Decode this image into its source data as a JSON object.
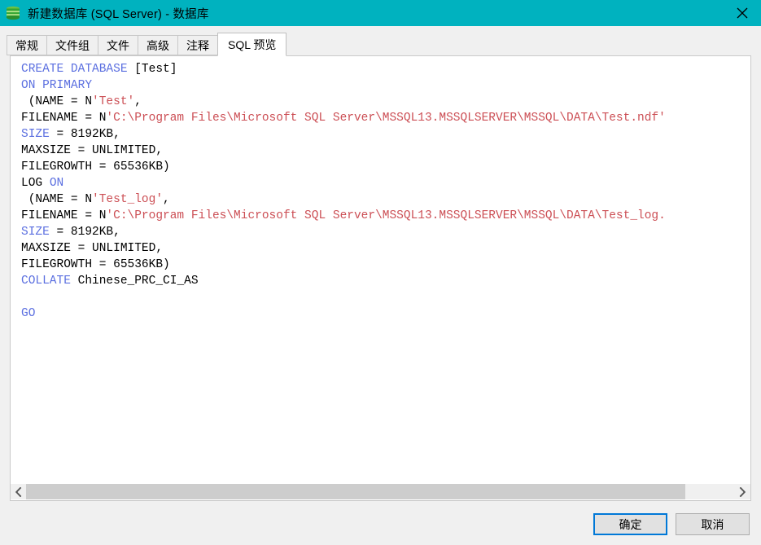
{
  "window": {
    "title": "新建数据库 (SQL Server) - 数据库",
    "icon": "database-icon",
    "close_label": "✕",
    "titlebar_color": "#00b2bf"
  },
  "tabs": [
    {
      "label": "常规",
      "active": false
    },
    {
      "label": "文件组",
      "active": false
    },
    {
      "label": "文件",
      "active": false
    },
    {
      "label": "高级",
      "active": false
    },
    {
      "label": "注释",
      "active": false
    },
    {
      "label": "SQL 预览",
      "active": true
    }
  ],
  "sql_preview": {
    "lines": [
      [
        {
          "t": "CREATE DATABASE ",
          "c": "kw"
        },
        {
          "t": "[Test]",
          "c": ""
        }
      ],
      [
        {
          "t": "ON PRIMARY",
          "c": "kw"
        }
      ],
      [
        {
          "t": " (NAME = N",
          "c": ""
        },
        {
          "t": "'Test'",
          "c": "str"
        },
        {
          "t": ",",
          "c": ""
        }
      ],
      [
        {
          "t": "FILENAME = N",
          "c": ""
        },
        {
          "t": "'C:\\Program Files\\Microsoft SQL Server\\MSSQL13.MSSQLSERVER\\MSSQL\\DATA\\Test.ndf'",
          "c": "str"
        }
      ],
      [
        {
          "t": "SIZE",
          "c": "kw"
        },
        {
          "t": " = 8192KB,",
          "c": ""
        }
      ],
      [
        {
          "t": "MAXSIZE = UNLIMITED,",
          "c": ""
        }
      ],
      [
        {
          "t": "FILEGROWTH = 65536KB)",
          "c": ""
        }
      ],
      [
        {
          "t": "LOG ",
          "c": ""
        },
        {
          "t": "ON",
          "c": "kw"
        }
      ],
      [
        {
          "t": " (NAME = N",
          "c": ""
        },
        {
          "t": "'Test_log'",
          "c": "str"
        },
        {
          "t": ",",
          "c": ""
        }
      ],
      [
        {
          "t": "FILENAME = N",
          "c": ""
        },
        {
          "t": "'C:\\Program Files\\Microsoft SQL Server\\MSSQL13.MSSQLSERVER\\MSSQL\\DATA\\Test_log.",
          "c": "str"
        }
      ],
      [
        {
          "t": "SIZE",
          "c": "kw"
        },
        {
          "t": " = 8192KB,",
          "c": ""
        }
      ],
      [
        {
          "t": "MAXSIZE = UNLIMITED,",
          "c": ""
        }
      ],
      [
        {
          "t": "FILEGROWTH = 65536KB)",
          "c": ""
        }
      ],
      [
        {
          "t": "COLLATE",
          "c": "kw"
        },
        {
          "t": " Chinese_PRC_CI_AS",
          "c": ""
        }
      ],
      [],
      [
        {
          "t": "GO",
          "c": "kw"
        }
      ]
    ],
    "keyword_color": "#5b6fe0",
    "string_color": "#cc4f55",
    "text_color": "#000000"
  },
  "scrollbar": {
    "left_arrow": "‹",
    "right_arrow": "›",
    "thumb_percent": 93
  },
  "footer": {
    "ok_label": "确定",
    "cancel_label": "取消",
    "focus_color": "#0078d7"
  }
}
